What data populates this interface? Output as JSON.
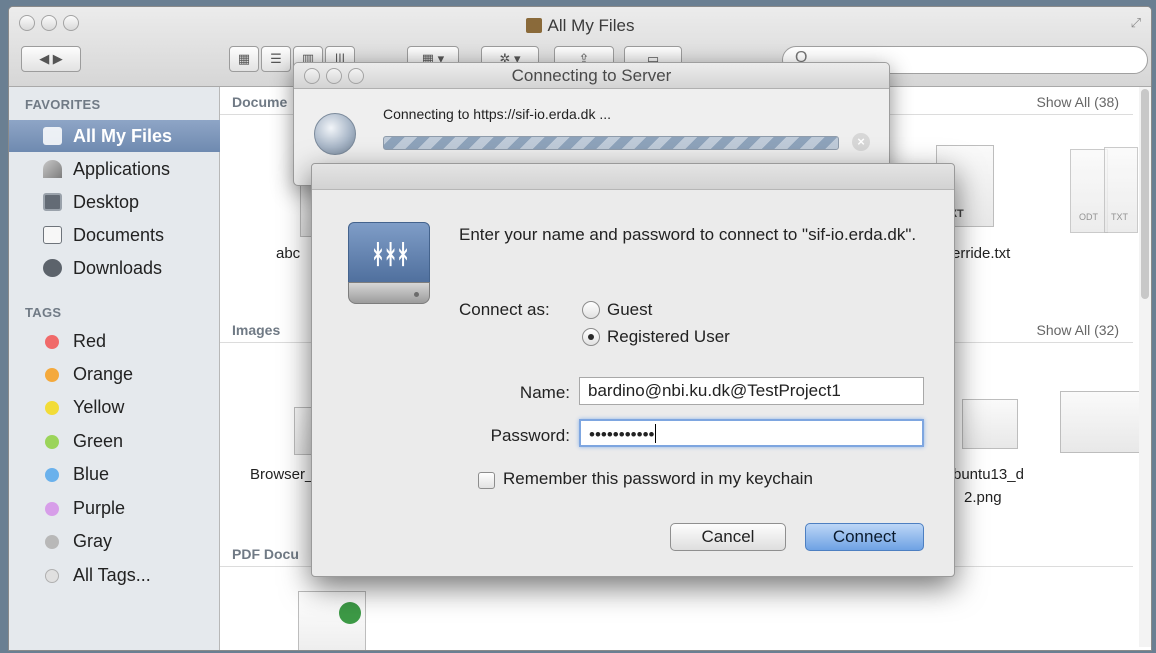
{
  "finder": {
    "title": "All My Files",
    "resize_glyph": "⤢",
    "search_glyph": "Q",
    "toolbar_buttons": [
      {
        "icon": "back-forward-icon",
        "glyph": "◀ ▶"
      },
      {
        "icon": "icon-view-icon",
        "glyph": "▦"
      },
      {
        "icon": "list-view-icon",
        "glyph": "☰"
      },
      {
        "icon": "column-view-icon",
        "glyph": "▥"
      },
      {
        "icon": "cover-flow-icon",
        "glyph": "|||"
      },
      {
        "icon": "arrange-icon",
        "glyph": "▦ ▾"
      },
      {
        "icon": "action-gear-icon",
        "glyph": "✲ ▾"
      },
      {
        "icon": "share-icon",
        "glyph": "⇪"
      },
      {
        "icon": "tags-icon",
        "glyph": "▭"
      }
    ],
    "sidebar": {
      "favorites_header": "FAVORITES",
      "favorites": [
        {
          "label": "All My Files",
          "icon": "all-my-files-icon"
        },
        {
          "label": "Applications",
          "icon": "applications-icon"
        },
        {
          "label": "Desktop",
          "icon": "desktop-icon"
        },
        {
          "label": "Documents",
          "icon": "documents-icon"
        },
        {
          "label": "Downloads",
          "icon": "downloads-icon"
        }
      ],
      "tags_header": "TAGS",
      "tags": [
        {
          "label": "Red",
          "color": "#f06a6a"
        },
        {
          "label": "Orange",
          "color": "#f4a93c"
        },
        {
          "label": "Yellow",
          "color": "#f2dc38"
        },
        {
          "label": "Green",
          "color": "#9bd45a"
        },
        {
          "label": "Blue",
          "color": "#6ab1ec"
        },
        {
          "label": "Purple",
          "color": "#d79ee9"
        },
        {
          "label": "Gray",
          "color": "#b8b8b8"
        },
        {
          "label": "All Tags...",
          "color": "#e0e0e0"
        }
      ]
    },
    "sections": {
      "documents": {
        "label": "Docume",
        "show_all": "Show All (38)",
        "file1": "abc",
        "file2": "erride.txt",
        "doc_ext1": "TXT",
        "doc_ext2": "ODT",
        "doc_ext3": "TXT"
      },
      "images": {
        "label": "Images",
        "show_all": "Show All (32)",
        "file1": "Browser_",
        "file2_line1": "buntu13_d",
        "file2_line2": "2.png"
      },
      "pdf": {
        "label": "PDF Docu"
      }
    }
  },
  "connecting": {
    "title": "Connecting to Server",
    "message": "Connecting to https://sif-io.erda.dk ...",
    "stop_glyph": "×"
  },
  "auth": {
    "prompt": "Enter your name and password to connect to \"sif-io.erda.dk\".",
    "connect_as_label": "Connect as:",
    "guest_label": "Guest",
    "registered_label": "Registered User",
    "selected": "Registered User",
    "name_label": "Name:",
    "name_value": "bardino@nbi.ku.dk@TestProject1",
    "password_label": "Password:",
    "password_value": "•••••••••••",
    "remember_label": "Remember this password in my keychain",
    "remember_checked": false,
    "cancel_label": "Cancel",
    "connect_label": "Connect"
  }
}
